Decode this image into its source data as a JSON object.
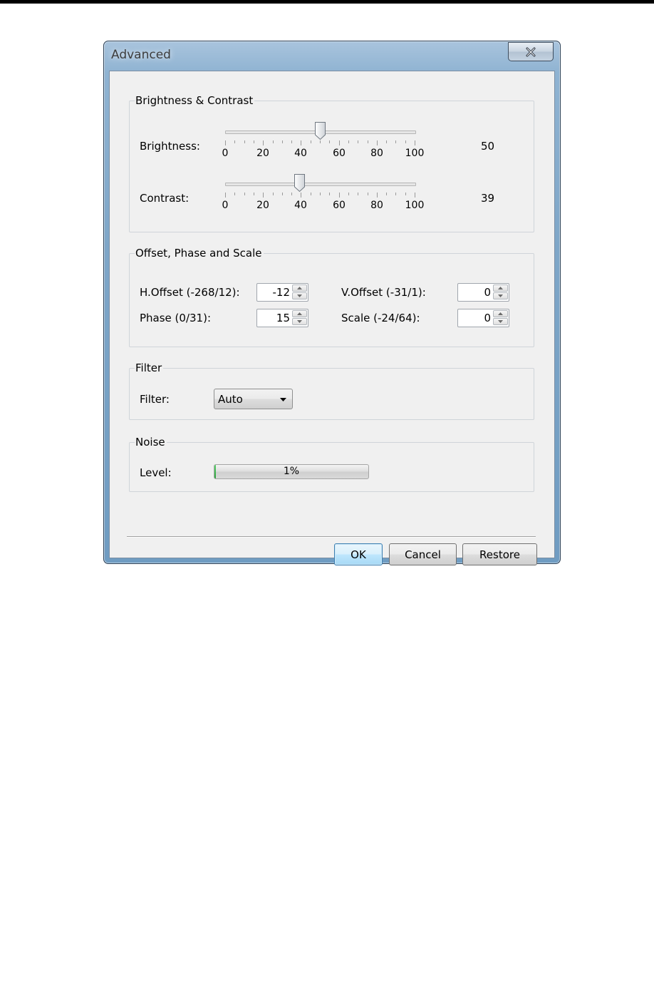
{
  "window": {
    "title": "Advanced",
    "close_symbol": "X"
  },
  "brightness_contrast": {
    "legend": "Brightness & Contrast",
    "brightness": {
      "label": "Brightness:",
      "value": "50",
      "level": 50
    },
    "contrast": {
      "label": "Contrast:",
      "value": "39",
      "level": 39
    },
    "scale_labels": [
      "0",
      "20",
      "40",
      "60",
      "80",
      "100"
    ]
  },
  "offset_phase_scale": {
    "legend": "Offset, Phase and Scale",
    "h_offset": {
      "label": "H.Offset (-268/12):",
      "value": "-12"
    },
    "v_offset": {
      "label": "V.Offset (-31/1):",
      "value": "0"
    },
    "phase": {
      "label": "Phase (0/31):",
      "value": "15"
    },
    "scale": {
      "label": "Scale (-24/64):",
      "value": "0"
    }
  },
  "filter": {
    "legend": "Filter",
    "label": "Filter:",
    "selected": "Auto"
  },
  "noise": {
    "legend": "Noise",
    "label": "Level:",
    "value_text": "1%",
    "level": 0.01
  },
  "buttons": {
    "ok": "OK",
    "cancel": "Cancel",
    "restore": "Restore"
  }
}
